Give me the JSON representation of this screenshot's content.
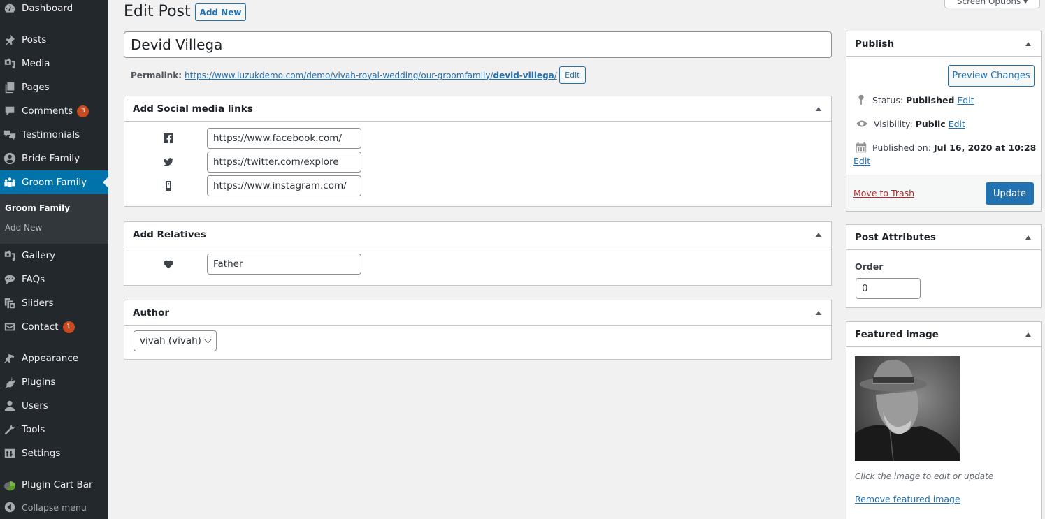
{
  "sidebar": {
    "items": [
      {
        "label": "Dashboard",
        "icon": "dashboard-icon"
      },
      {
        "label": "Posts",
        "icon": "pin-icon"
      },
      {
        "label": "Media",
        "icon": "media-icon"
      },
      {
        "label": "Pages",
        "icon": "pages-icon"
      },
      {
        "label": "Comments",
        "icon": "comment-icon",
        "badge": "3"
      },
      {
        "label": "Testimonials",
        "icon": "testimonial-icon"
      },
      {
        "label": "Bride Family",
        "icon": "user-circle-icon"
      },
      {
        "label": "Groom Family",
        "icon": "groups-icon",
        "active": true
      },
      {
        "label": "Gallery",
        "icon": "gallery-icon"
      },
      {
        "label": "FAQs",
        "icon": "chat-bubble-icon"
      },
      {
        "label": "Sliders",
        "icon": "slides-icon"
      },
      {
        "label": "Contact",
        "icon": "email-icon",
        "badge": "1"
      },
      {
        "label": "Appearance",
        "icon": "paintbrush-icon"
      },
      {
        "label": "Plugins",
        "icon": "plug-icon"
      },
      {
        "label": "Users",
        "icon": "user-icon"
      },
      {
        "label": "Tools",
        "icon": "wrench-icon"
      },
      {
        "label": "Settings",
        "icon": "settings-icon"
      },
      {
        "label": "Plugin Cart Bar",
        "icon": "pie-chart-icon"
      }
    ],
    "submenu": [
      {
        "label": "Groom Family",
        "current": true
      },
      {
        "label": "Add New"
      }
    ],
    "collapse_label": "Collapse menu"
  },
  "header": {
    "title": "Edit Post",
    "add_new_label": "Add New",
    "screen_options_label": "Screen Options ▾"
  },
  "post": {
    "title": "Devid Villega",
    "permalink_label": "Permalink:",
    "permalink_base": "https://www.luzukdemo.com/demo/vivah-royal-wedding/our-groomfamily/",
    "permalink_slug": "devid-villega",
    "permalink_trailing": "/",
    "permalink_edit_label": "Edit"
  },
  "social_box": {
    "title": "Add Social media links",
    "links": [
      {
        "icon": "facebook-icon",
        "value": "https://www.facebook.com/"
      },
      {
        "icon": "twitter-icon",
        "value": "https://twitter.com/explore"
      },
      {
        "icon": "smartphone-icon",
        "value": "https://www.instagram.com/"
      }
    ]
  },
  "relatives_box": {
    "title": "Add Relatives",
    "relation_value": "Father"
  },
  "author_box": {
    "title": "Author",
    "selected": "vivah (vivah)"
  },
  "publish_box": {
    "title": "Publish",
    "preview_label": "Preview Changes",
    "status_label": "Status:",
    "status_value": "Published",
    "visibility_label": "Visibility:",
    "visibility_value": "Public",
    "published_label": "Published on:",
    "published_value": "Jul 16, 2020 at 10:28",
    "edit_label": "Edit",
    "trash_label": "Move to Trash",
    "update_label": "Update"
  },
  "attributes_box": {
    "title": "Post Attributes",
    "order_label": "Order",
    "order_value": "0"
  },
  "featured_box": {
    "title": "Featured image",
    "image_alt": "Black and white portrait of bearded man in a hat",
    "hint": "Click the image to edit or update",
    "remove_label": "Remove featured image"
  },
  "colors": {
    "sidebar_bg": "#23282d",
    "active_bg": "#0073aa",
    "accent": "#2271b1",
    "badge": "#ca4a1f",
    "trash": "#b32d2e"
  }
}
